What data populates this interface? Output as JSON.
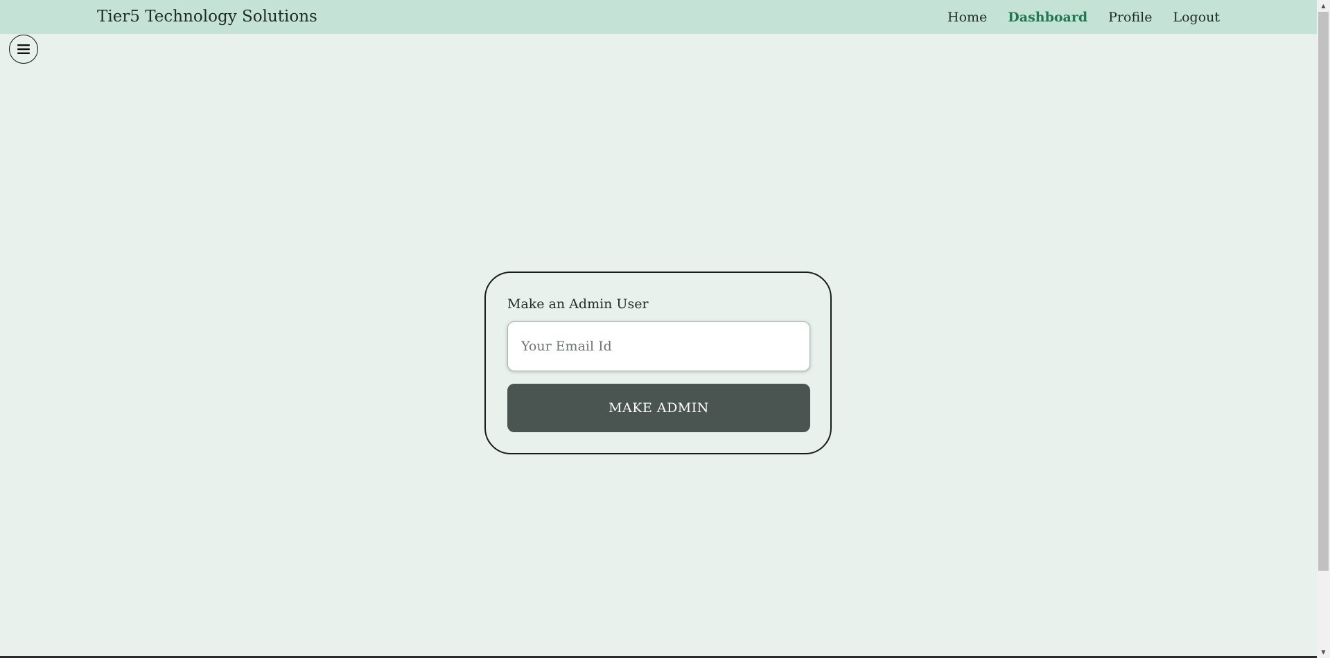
{
  "header": {
    "brand": "Tier5 Technology Solutions",
    "nav": [
      {
        "label": "Home",
        "active": false
      },
      {
        "label": "Dashboard",
        "active": true
      },
      {
        "label": "Profile",
        "active": false
      },
      {
        "label": "Logout",
        "active": false
      }
    ]
  },
  "sidebar_toggle": {
    "icon": "hamburger-menu-icon"
  },
  "form": {
    "label": "Make an Admin User",
    "email_placeholder": "Your Email Id",
    "email_value": "",
    "submit_label": "MAKE ADMIN"
  },
  "colors": {
    "navbar_bg": "#c5e2d7",
    "page_bg": "#e8f1ec",
    "active_link": "#1f7a52",
    "button_bg": "#4a5450"
  }
}
